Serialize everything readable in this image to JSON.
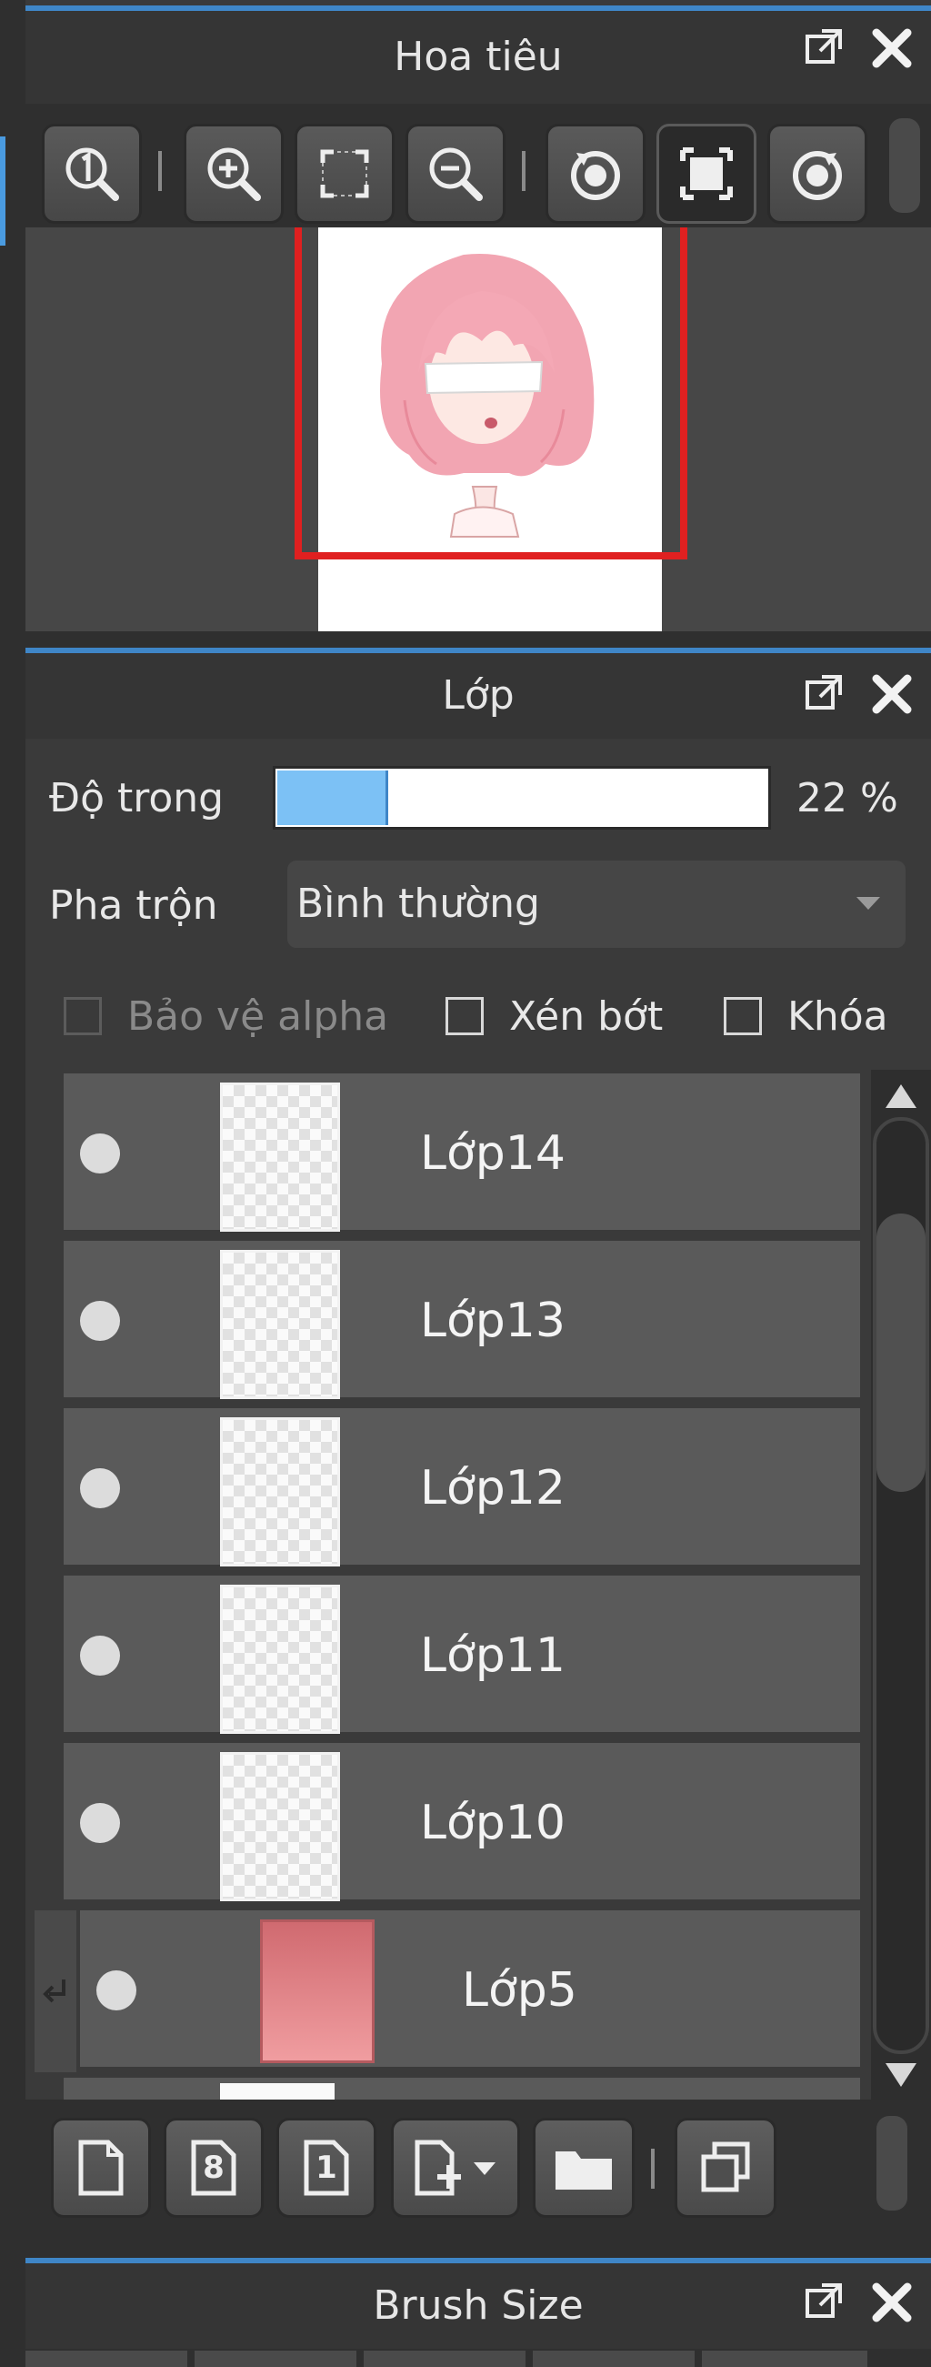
{
  "navigator": {
    "title": "Hoa tiêu",
    "tools": [
      "zoom-reset",
      "zoom-in",
      "fit-screen",
      "zoom-out",
      "rotate-left",
      "actual-size",
      "rotate-right"
    ]
  },
  "layers_panel": {
    "title": "Lớp",
    "opacity_label": "Độ trong",
    "opacity_value": "22 %",
    "opacity_fraction": 0.22,
    "blend_label": "Pha trộn",
    "blend_value": "Bình thường",
    "protect_alpha": "Bảo vệ alpha",
    "clipping": "Xén bớt",
    "lock": "Khóa",
    "layers": [
      {
        "name": "Lớp14"
      },
      {
        "name": "Lớp13"
      },
      {
        "name": "Lớp12"
      },
      {
        "name": "Lớp11"
      },
      {
        "name": "Lớp10"
      },
      {
        "name": "Lớp5"
      }
    ],
    "bottom_tools": [
      "new-layer",
      "new-layer-8bit",
      "new-layer-1bit",
      "add-layer-menu",
      "new-folder",
      "duplicate-layer"
    ],
    "digits": {
      "eight": "8",
      "one": "1"
    }
  },
  "brush_panel": {
    "title": "Brush Size"
  },
  "colors": {
    "accent": "#3f86c7",
    "opacity_fill": "#7cc1f5",
    "selection": "#e02020"
  }
}
